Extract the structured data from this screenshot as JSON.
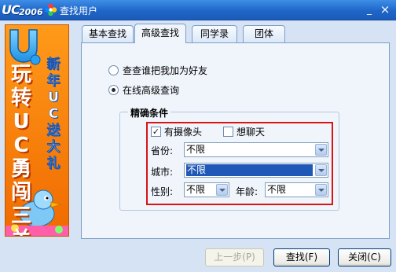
{
  "window": {
    "logo_text": "UC",
    "logo_year": "2006",
    "title": "查找用户",
    "minimize_glyph": "_",
    "close_glyph": "×"
  },
  "banner": {
    "line1": "玩转UC勇闯三关",
    "line2": "新年UC送大礼"
  },
  "tabs": [
    {
      "label": "基本查找",
      "active": false
    },
    {
      "label": "高级查找",
      "active": true
    },
    {
      "label": "同学录",
      "active": false
    },
    {
      "label": "团体",
      "active": false
    }
  ],
  "search_mode": {
    "options": [
      {
        "label": "查查谁把我加为好友",
        "selected": false
      },
      {
        "label": "在线高级查询",
        "selected": true
      }
    ]
  },
  "criteria": {
    "group_title": "精确条件",
    "has_camera": {
      "label": "有摄像头",
      "checked": true,
      "check_glyph": "✓"
    },
    "want_chat": {
      "label": "想聊天",
      "checked": false
    },
    "province": {
      "label": "省份:",
      "value": "不限"
    },
    "city": {
      "label": "城市:",
      "value": "不限"
    },
    "gender": {
      "label": "性别:",
      "value": "不限"
    },
    "age": {
      "label": "年龄:",
      "value": "不限"
    }
  },
  "buttons": {
    "prev": "上一步(P)",
    "search": "查找(F)",
    "close": "关闭(C)"
  },
  "colors": {
    "titlebar": "#1f66c9",
    "highlight_box": "#d81414",
    "selection": "#2058b8"
  }
}
